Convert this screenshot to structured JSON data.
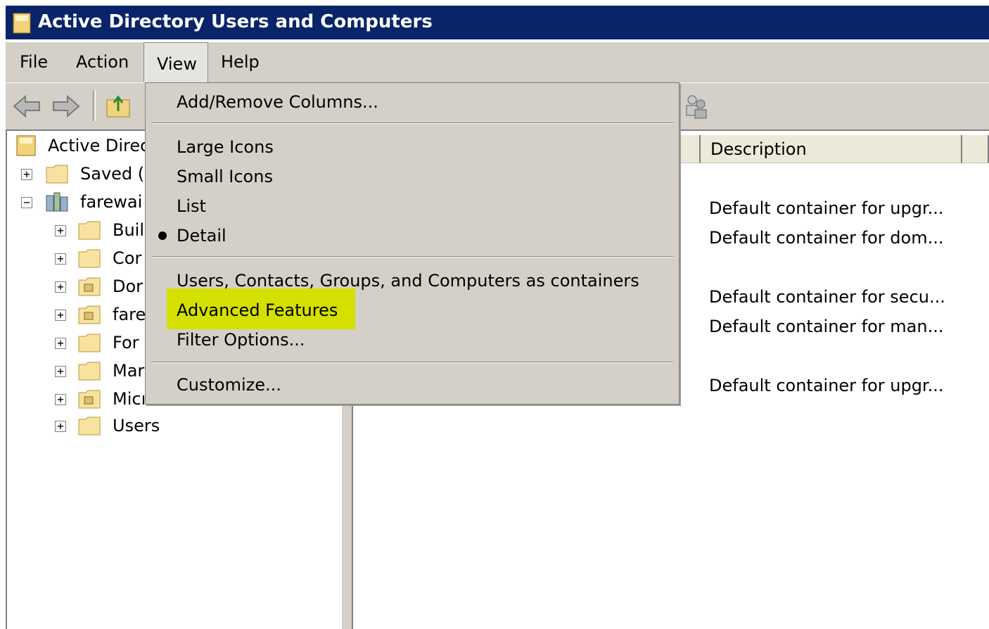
{
  "window": {
    "title": "Active Directory Users and Computers"
  },
  "menubar": {
    "items": [
      "File",
      "Action",
      "View",
      "Help"
    ]
  },
  "view_menu": {
    "add_remove_columns": "Add/Remove Columns...",
    "large_icons": "Large Icons",
    "small_icons": "Small Icons",
    "list": "List",
    "detail": "Detail",
    "users_as_containers": "Users, Contacts, Groups, and Computers as containers",
    "advanced_features": "Advanced Features",
    "filter_options": "Filter Options...",
    "customize": "Customize..."
  },
  "tree": {
    "root": "Active Direc",
    "saved": "Saved (",
    "domain": "farewai",
    "children": [
      "Buil",
      "Cor",
      "Dor",
      "fare",
      "For",
      "Mar",
      "Micı",
      "Users"
    ]
  },
  "list": {
    "header_description": "Description",
    "descriptions": [
      "Default container for upgr...",
      "Default container for dom...",
      "Default container for secu...",
      "Default container for man...",
      "Default container for upgr..."
    ]
  },
  "colors": {
    "title_bar": "#0a246a",
    "highlight": "#d4e000",
    "menu_bg": "#d4d0c8"
  }
}
